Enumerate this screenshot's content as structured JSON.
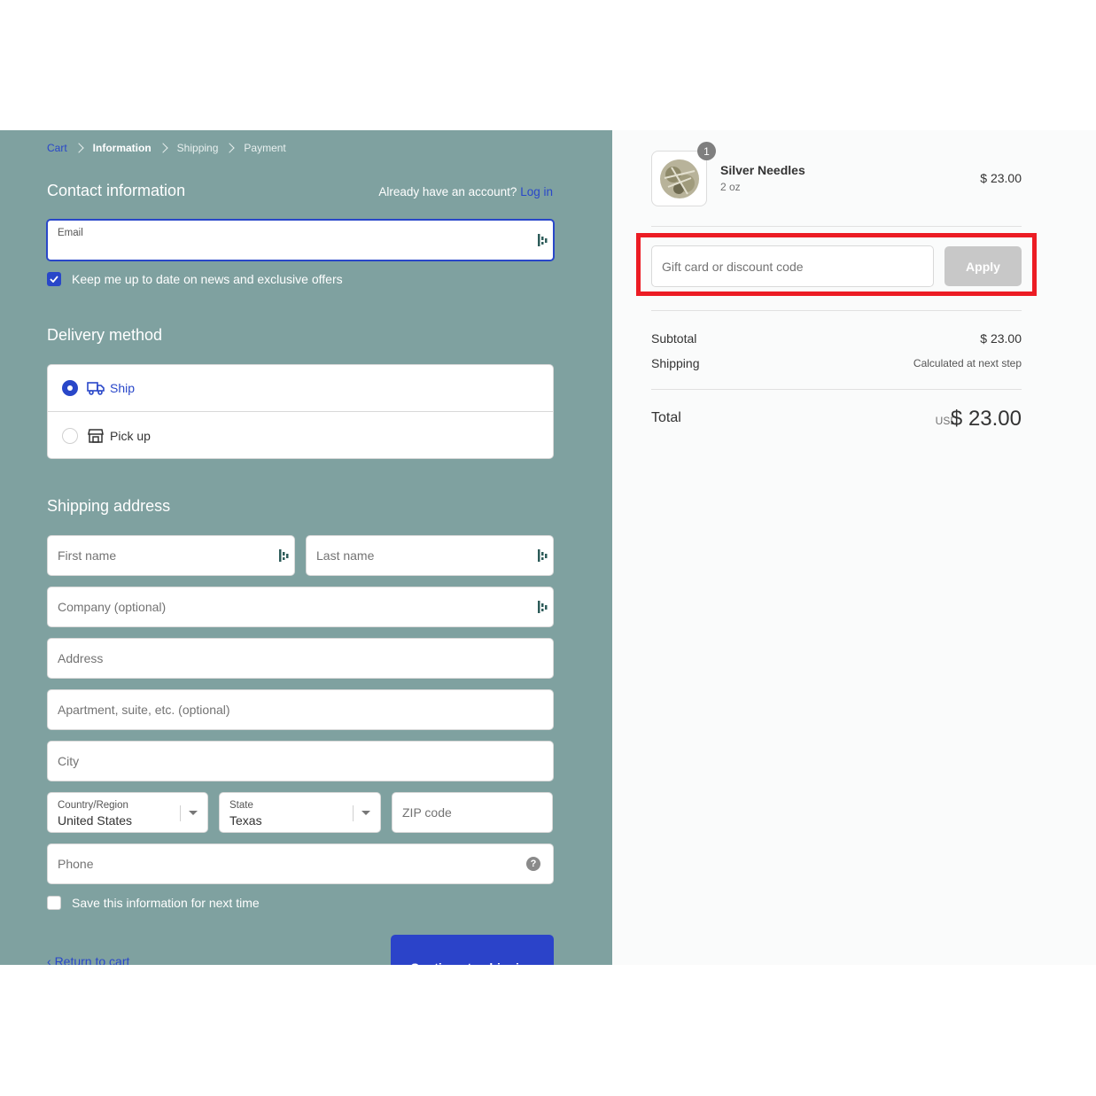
{
  "breadcrumb": {
    "cart": "Cart",
    "information": "Information",
    "shipping": "Shipping",
    "payment": "Payment"
  },
  "contact": {
    "title": "Contact information",
    "already_text": "Already have an account?",
    "login_link": "Log in",
    "email_label": "Email",
    "email_value": "",
    "newsletter_label": "Keep me up to date on news and exclusive offers",
    "newsletter_checked": true
  },
  "delivery": {
    "title": "Delivery method",
    "options": [
      {
        "label": "Ship",
        "icon": "truck-icon",
        "selected": true
      },
      {
        "label": "Pick up",
        "icon": "store-icon",
        "selected": false
      }
    ]
  },
  "shipping": {
    "title": "Shipping address",
    "first_name_placeholder": "First name",
    "last_name_placeholder": "Last name",
    "company_placeholder": "Company (optional)",
    "address_placeholder": "Address",
    "apartment_placeholder": "Apartment, suite, etc. (optional)",
    "city_placeholder": "City",
    "country_label": "Country/Region",
    "country_value": "United States",
    "state_label": "State",
    "state_value": "Texas",
    "zip_placeholder": "ZIP code",
    "phone_placeholder": "Phone",
    "save_info_label": "Save this information for next time"
  },
  "actions": {
    "return_link": "Return to cart",
    "continue_button": "Continue to shipping"
  },
  "order": {
    "product": {
      "name": "Silver Needles",
      "variant": "2 oz",
      "price": "$ 23.00",
      "quantity": "1"
    },
    "discount_placeholder": "Gift card or discount code",
    "apply_button": "Apply",
    "subtotal_label": "Subtotal",
    "subtotal_value": "$ 23.00",
    "shipping_label": "Shipping",
    "shipping_value": "Calculated at next step",
    "total_label": "Total",
    "total_currency": "USD",
    "total_value": "$ 23.00"
  },
  "colors": {
    "accent": "#2947c9",
    "left_bg": "#7fa1a0",
    "highlight": "#ec1c24",
    "apply_disabled": "#c8c8c8"
  }
}
